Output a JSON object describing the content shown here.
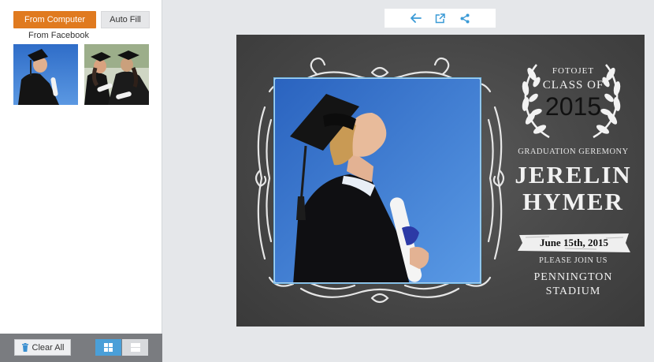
{
  "left_panel": {
    "tabs": {
      "from_computer": "From Computer",
      "auto_fill": "Auto Fill"
    },
    "facebook_label": "From Facebook",
    "thumbnails": [
      "graduate-woman-photo",
      "two-graduates-photo"
    ],
    "clear_all": "Clear All"
  },
  "toolbar": {
    "icons": [
      "back-arrow-icon",
      "export-icon",
      "share-icon"
    ]
  },
  "card": {
    "brand": "FOTOJET",
    "class_of": "CLASS OF",
    "year": "2015",
    "ceremony": "GRADUATION GEREMONY",
    "first_name": "JERELIN",
    "last_name": "HYMER",
    "date": "June 15th, 2015",
    "invite": "PLEASE JOIN US",
    "venue_line1": "PENNINGTON",
    "venue_line2": "STADIUM"
  },
  "colors": {
    "accent_orange": "#e07a1f",
    "accent_blue": "#4a9fd8",
    "chalkboard": "#4a4a4a",
    "sky_blue": "#3a78cf"
  }
}
